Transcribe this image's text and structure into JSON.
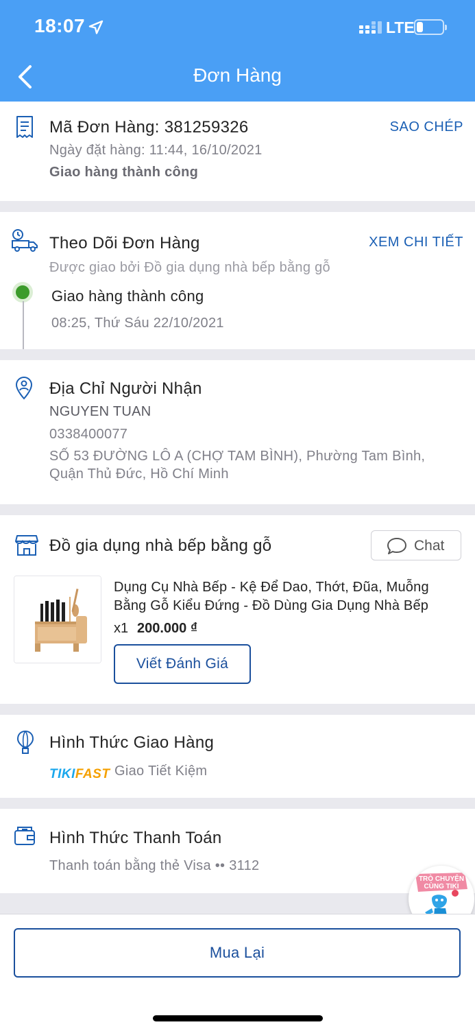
{
  "status_bar": {
    "time": "18:07",
    "network": "LTE"
  },
  "header": {
    "title": "Đơn Hàng"
  },
  "order": {
    "id_label": "Mã Đơn Hàng: 381259326",
    "copy_label": "SAO CHÉP",
    "date": "Ngày đặt hàng: 11:44, 16/10/2021",
    "status": "Giao hàng thành công"
  },
  "tracking": {
    "title": "Theo Dõi Đơn Hàng",
    "detail_link": "XEM CHI TIẾT",
    "delivered_by": "Được giao bởi Đồ gia dụng nhà bếp bằng gỗ",
    "event_status": "Giao hàng thành công",
    "event_time": "08:25, Thứ Sáu 22/10/2021"
  },
  "recipient": {
    "title": "Địa Chỉ Người Nhận",
    "name": "NGUYEN TUAN",
    "phone": "0338400077",
    "address_line1": "SỐ 53 ĐƯỜNG LÔ A (CHỢ TAM BÌNH), Phường Tam Bình,",
    "address_line2": "Quận Thủ Đức, Hồ Chí Minh"
  },
  "shop": {
    "name": "Đồ gia dụng nhà bếp bằng gỗ",
    "chat_label": "Chat",
    "product": {
      "name": "Dụng Cụ Nhà Bếp - Kệ Để Dao, Thớt, Đũa, Muỗng Bằng Gỗ Kiểu Đứng - Đồ Dùng Gia Dụng Nhà Bếp",
      "quantity": "x1",
      "price": "200.000 ₫",
      "review_label": "Viết Đánh Giá"
    }
  },
  "shipping": {
    "title": "Hình Thức Giao Hàng",
    "logo_tiki": "TIKI",
    "logo_fast": "FAST",
    "method": "Giao Tiết Kiệm"
  },
  "payment": {
    "title": "Hình Thức Thanh Toán",
    "method": "Thanh toán bằng thẻ Visa •• 3112"
  },
  "chat_bubble": {
    "line1": "TRÒ CHUYỆN",
    "line2": "CÙNG TIKI"
  },
  "actions": {
    "rebuy_label": "Mua Lại"
  },
  "colors": {
    "header": "#4a9ff5",
    "link": "#1a5fb4",
    "button_border": "#1a4f9c",
    "success": "#3c9b2b"
  }
}
